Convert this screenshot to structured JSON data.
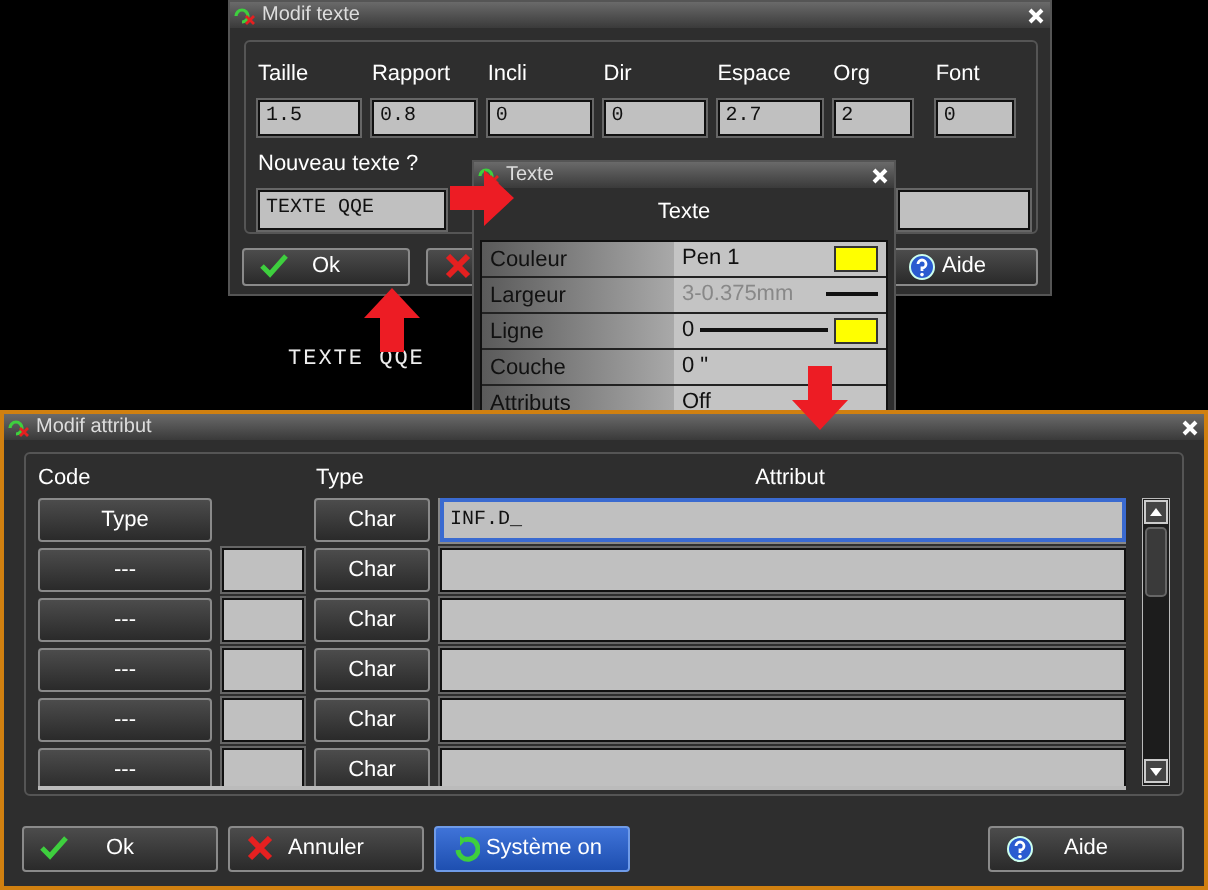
{
  "modif_texte": {
    "title": "Modif texte",
    "fields": [
      {
        "label": "Taille",
        "value": "1.5"
      },
      {
        "label": "Rapport",
        "value": "0.8"
      },
      {
        "label": "Incli",
        "value": "0"
      },
      {
        "label": "Dir",
        "value": "0"
      },
      {
        "label": "Espace",
        "value": "2.7"
      },
      {
        "label": "Org",
        "value": "2"
      },
      {
        "label": "Font",
        "value": "0"
      }
    ],
    "prompt": "Nouveau texte ?",
    "new_text": "TEXTE QQE",
    "buttons": [
      {
        "kind": "ok",
        "label": "Ok"
      },
      {
        "kind": "cancel"
      },
      {
        "kind": "help",
        "label": "Aide"
      }
    ]
  },
  "canvas_text": "TEXTE QQE",
  "texte": {
    "title": "Texte",
    "heading": "Texte",
    "rows": [
      {
        "kind": "color",
        "label": "Couleur",
        "value": "Pen 1",
        "color": "#ffff00"
      },
      {
        "kind": "width",
        "label": "Largeur",
        "value": "3-0.375mm",
        "disabled": true
      },
      {
        "kind": "line",
        "label": "Ligne",
        "value": "0",
        "color": "#ffff00"
      },
      {
        "kind": "plain",
        "label": "Couche",
        "value": "0 \""
      },
      {
        "kind": "plain",
        "label": "Attributs",
        "value": "Off"
      }
    ]
  },
  "modif_attribut": {
    "title": "Modif attribut",
    "columns": [
      "Code",
      "Type",
      "Attribut"
    ],
    "rows": [
      {
        "kind": "type",
        "code": "Type",
        "type": "Char",
        "attribut": "INF.D_",
        "selected": true
      },
      {
        "kind": "value",
        "code": "---",
        "type": "Char",
        "selected": false
      },
      {
        "kind": "value",
        "code": "---",
        "type": "Char",
        "selected": false
      },
      {
        "kind": "value",
        "code": "---",
        "type": "Char",
        "selected": false
      },
      {
        "kind": "value",
        "code": "---",
        "type": "Char",
        "selected": false
      },
      {
        "kind": "value",
        "code": "---",
        "type": "Char",
        "selected": false
      }
    ],
    "buttons": [
      {
        "kind": "ok",
        "label": "Ok",
        "on": false
      },
      {
        "kind": "cancel",
        "label": "Annuler",
        "on": false
      },
      {
        "kind": "system",
        "label": "Système on",
        "on": true
      },
      {
        "kind": "help",
        "label": "Aide",
        "on": false
      }
    ]
  }
}
